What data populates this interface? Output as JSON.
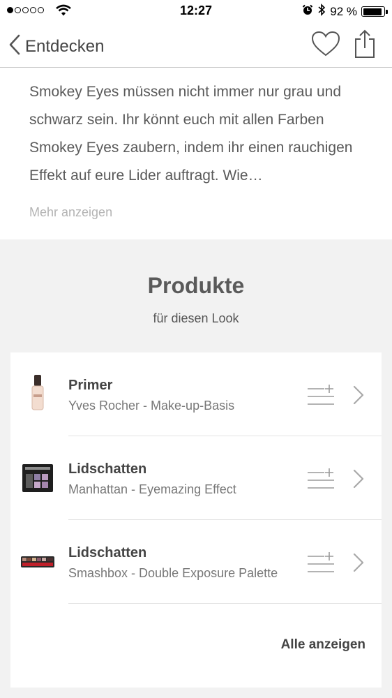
{
  "status_bar": {
    "time": "12:27",
    "battery": "92 %",
    "battery_level": 0.92,
    "signal_filled": 1,
    "signal_total": 5
  },
  "nav": {
    "back_label": "Entdecken"
  },
  "description": {
    "text": "Smokey Eyes müssen nicht immer nur grau und schwarz sein. Ihr könnt euch mit allen Farben Smokey Eyes zaubern, indem ihr einen rauchigen Effekt auf eure Lider auftragt. Wie…",
    "more_label": "Mehr anzeigen"
  },
  "products": {
    "title": "Produkte",
    "subtitle": "für diesen Look",
    "items": [
      {
        "name": "Primer",
        "detail": "Yves Rocher - Make-up-Basis",
        "icon": "foundation-bottle-icon"
      },
      {
        "name": "Lidschatten",
        "detail": "Manhattan - Eyemazing Effect",
        "icon": "eyeshadow-palette-icon"
      },
      {
        "name": "Lidschatten",
        "detail": "Smashbox - Double Exposure Palette",
        "icon": "eyeshadow-palette-icon"
      }
    ],
    "show_all_label": "Alle anzeigen"
  },
  "colors": {
    "text_primary": "#444444",
    "text_secondary": "#777777",
    "section_bg": "#f2f2f2",
    "divider": "#e3e3e3"
  }
}
